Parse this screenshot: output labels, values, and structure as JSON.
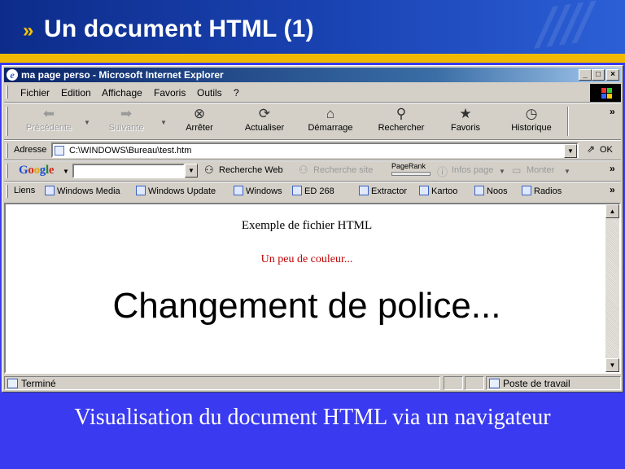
{
  "slide": {
    "title": "Un document HTML (1)",
    "chevron": "»",
    "caption": "Visualisation du document HTML via un navigateur"
  },
  "window": {
    "title": "ma page perso - Microsoft Internet Explorer",
    "controls": {
      "minimize": "_",
      "maximize": "□",
      "close": "×"
    }
  },
  "menu": [
    "Fichier",
    "Edition",
    "Affichage",
    "Favoris",
    "Outils",
    "?"
  ],
  "toolbar": {
    "back": "Précédente",
    "forward": "Suivante",
    "stop": "Arrêter",
    "refresh": "Actualiser",
    "home": "Démarrage",
    "search": "Rechercher",
    "favorites": "Favoris",
    "history": "Historique",
    "more": "»"
  },
  "address": {
    "label": "Adresse",
    "value": "C:\\WINDOWS\\Bureau\\test.htm",
    "go": "OK"
  },
  "google": {
    "logo_letters": [
      "G",
      "o",
      "o",
      "g",
      "l",
      "e"
    ],
    "search_web": "Recherche Web",
    "search_site": "Recherche site",
    "pagerank": "PageRank",
    "page_info": "Infos page",
    "up": "Monter"
  },
  "links": {
    "label": "Liens",
    "items": [
      "Windows Media",
      "Windows Update",
      "Windows",
      "ED 268",
      "Extractor",
      "Kartoo",
      "Noos",
      "Radios"
    ]
  },
  "page": {
    "line1": "Exemple de fichier HTML",
    "line2": "Un peu de couleur...",
    "line3": "Changement de police..."
  },
  "status": {
    "text": "Terminé",
    "zone": "Poste de travail"
  },
  "colors": {
    "google_blue": "#1f4fd6",
    "google_red": "#d22a1e",
    "google_yellow": "#e0a800",
    "google_green": "#1c8a2e",
    "line2": "#c00000"
  }
}
